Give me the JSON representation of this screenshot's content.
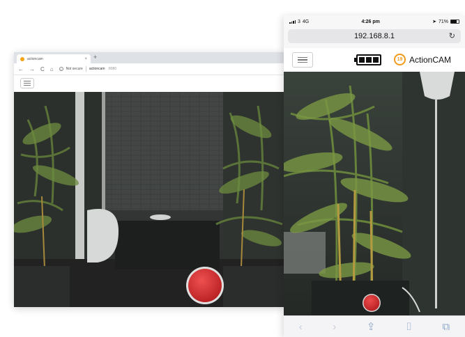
{
  "desktop": {
    "tab_title": "actioncam",
    "tab_close": "×",
    "new_tab": "+",
    "nav_back": "←",
    "nav_forward": "→",
    "nav_reload": "C",
    "nav_home": "⌂",
    "security_label": "Not secure",
    "url": "actioncam",
    "url_port": ":8080"
  },
  "phone": {
    "status": {
      "carrier": "3",
      "network": "4G",
      "time": "4:26 pm",
      "battery": "71%",
      "location_icon": "➤"
    },
    "url": "192.168.8.1",
    "reload": "↻",
    "logo_badge": "19",
    "logo_text": "ActionCAM",
    "toolbar": {
      "back": "‹",
      "forward": "›",
      "share": "⇪",
      "bookmarks": "⌷",
      "tabs": "⧉"
    }
  },
  "colors": {
    "record": "#d62c2c",
    "accent_orange": "#f29a1a"
  },
  "icons": [
    "hamburger-icon",
    "battery-icon",
    "record-button",
    "share-icon",
    "bookmarks-icon",
    "tabs-icon"
  ]
}
